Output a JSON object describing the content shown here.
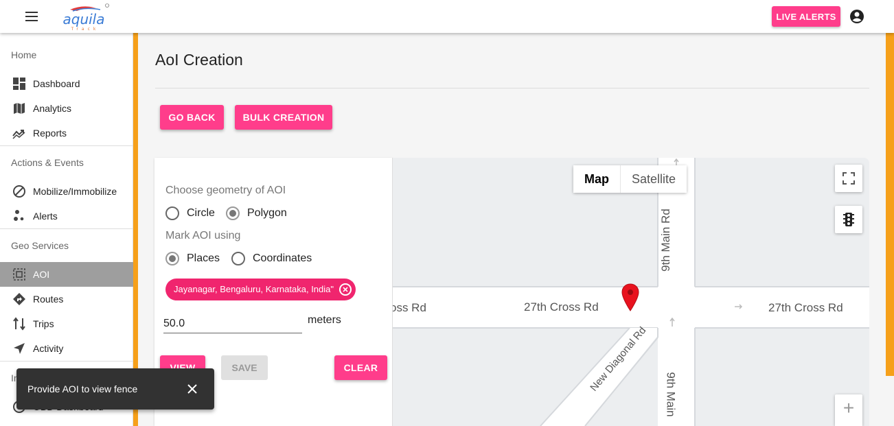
{
  "header": {
    "brand": "aquila",
    "brand_sub": "Track",
    "live_alerts_label": "LIVE ALERTS"
  },
  "sidebar": {
    "sections": [
      {
        "title": "Home"
      },
      {
        "title": "Actions & Events"
      },
      {
        "title": "Geo Services"
      },
      {
        "title": "In"
      }
    ],
    "items": [
      {
        "label": "Dashboard",
        "icon": "dashboard-icon"
      },
      {
        "label": "Analytics",
        "icon": "map-icon"
      },
      {
        "label": "Reports",
        "icon": "trending-icon"
      },
      {
        "label": "Mobilize/Immobilize",
        "icon": "block-icon"
      },
      {
        "label": "Alerts",
        "icon": "bubble-chart-icon"
      },
      {
        "label": "AOI",
        "icon": "select-area-icon",
        "active": true
      },
      {
        "label": "Routes",
        "icon": "directions-icon"
      },
      {
        "label": "Trips",
        "icon": "trips-icon"
      },
      {
        "label": "Activity",
        "icon": "navigation-icon"
      },
      {
        "label": "OBD Dashboard",
        "icon": "speedometer-icon"
      }
    ]
  },
  "main": {
    "title": "AoI Creation",
    "go_back_label": "GO BACK",
    "bulk_creation_label": "BULK CREATION"
  },
  "form": {
    "geometry_label": "Choose geometry of AOI",
    "geometry_options": [
      "Circle",
      "Polygon"
    ],
    "geometry_selected": "Polygon",
    "mark_label": "Mark AOI using",
    "mark_options": [
      "Places",
      "Coordinates"
    ],
    "mark_selected": "Places",
    "place_chip": "Jayanagar, Bengaluru, Karnataka, India\"",
    "radius_value": "50.0",
    "radius_unit": "meters",
    "view_label": "VIEW",
    "save_label": "SAVE",
    "clear_label": "CLEAR"
  },
  "map": {
    "type_options": [
      "Map",
      "Satellite"
    ],
    "type_selected": "Map",
    "roads": {
      "cross_left": "oss Rd",
      "cross_mid": "27th Cross Rd",
      "cross_right": "27th Cross Rd",
      "main_top": "9th Main Rd",
      "main_bottom": "9th Main",
      "diagonal": "New Diagonal Rd"
    },
    "zoom_in_label": "+"
  },
  "snackbar": {
    "message": "Provide AOI to view fence"
  },
  "colors": {
    "accent": "#ff3d8b",
    "chip": "#f0256e",
    "orange": "#f6a01a",
    "pin": "#e8121e"
  }
}
